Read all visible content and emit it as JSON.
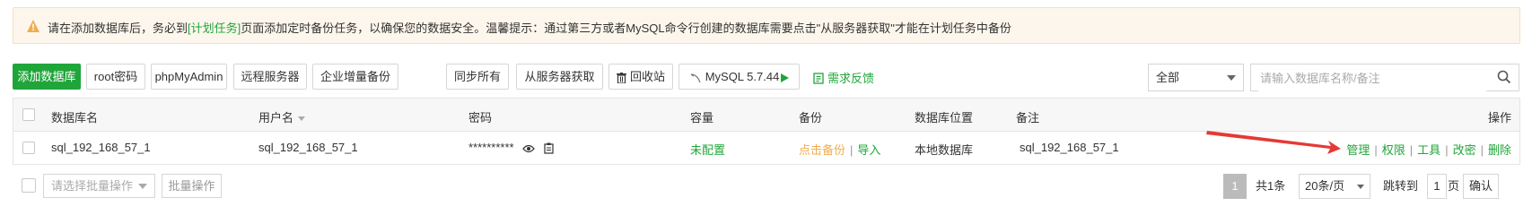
{
  "notice": {
    "prefix": "请在添加数据库后，务必到",
    "link": "[计划任务]",
    "suffix": "页面添加定时备份任务，以确保您的数据安全。温馨提示：通过第三方或者MySQL命令行创建的数据库需要点击\"从服务器获取\"才能在计划任务中备份"
  },
  "toolbar": {
    "add_db": "添加数据库",
    "root_pwd": "root密码",
    "phpmyadmin": "phpMyAdmin",
    "remote_server": "远程服务器",
    "enterprise_backup": "企业增量备份",
    "sync_all": "同步所有",
    "fetch_from_server": "从服务器获取",
    "recycle_bin": "回收站",
    "mysql_version": "MySQL 5.7.44",
    "feedback": "需求反馈"
  },
  "filter": {
    "selected": "全部",
    "search_placeholder": "请输入数据库名称/备注"
  },
  "table": {
    "headers": {
      "name": "数据库名",
      "user": "用户名",
      "password": "密码",
      "capacity": "容量",
      "backup": "备份",
      "location": "数据库位置",
      "remark": "备注",
      "actions": "操作"
    },
    "rows": [
      {
        "name": "sql_192_168_57_1",
        "user": "sql_192_168_57_1",
        "password": "**********",
        "capacity": "未配置",
        "backup": "点击备份",
        "import": "导入",
        "location": "本地数据库",
        "remark": "sql_192_168_57_1",
        "actions": {
          "manage": "管理",
          "permission": "权限",
          "tools": "工具",
          "change_pwd": "改密",
          "delete": "删除"
        }
      }
    ]
  },
  "footer": {
    "batch_placeholder": "请选择批量操作",
    "batch_button": "批量操作",
    "current_page": "1",
    "total": "共1条",
    "page_size": "20条/页",
    "jump_to": "跳转到",
    "jump_value": "1",
    "page_unit": "页",
    "confirm": "确认"
  },
  "colors": {
    "primary": "#20a53a",
    "warning": "#f0ad4e",
    "annotation_arrow": "#e53935"
  }
}
